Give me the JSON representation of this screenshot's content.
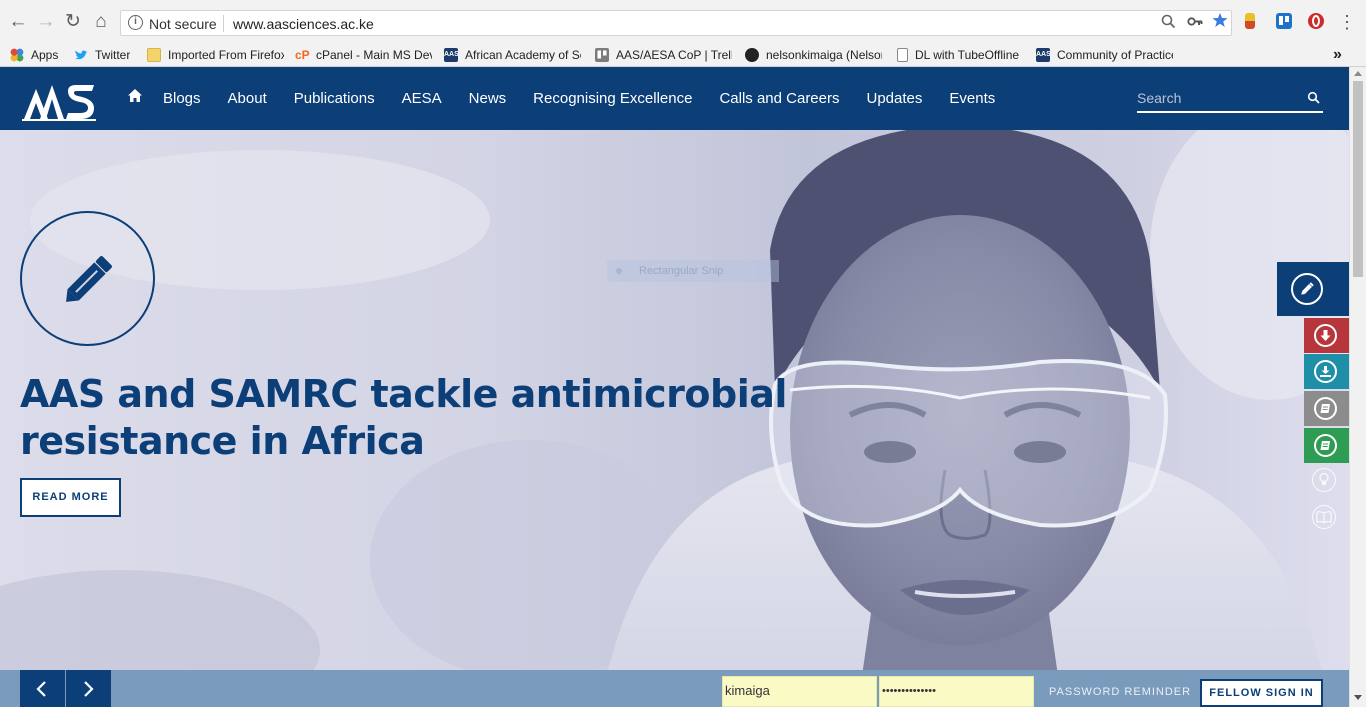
{
  "browser": {
    "back": "←",
    "forward": "→",
    "reload": "↻",
    "home": "⌂",
    "security_label": "Not secure",
    "url": "www.aasciences.ac.ke",
    "bookmarks_overflow": "»",
    "bookmarks": [
      {
        "label": "Apps",
        "icon": "apps-grid-icon"
      },
      {
        "label": "Twitter",
        "icon": "twitter-bird-icon"
      },
      {
        "label": "Imported From Firefox",
        "icon": "folder-icon"
      },
      {
        "label": "cPanel - Main MS Dev",
        "icon": "cpanel-icon"
      },
      {
        "label": "African Academy of Sciences",
        "icon": "aas-icon"
      },
      {
        "label": "AAS/AESA CoP | Trello",
        "icon": "trello-icon"
      },
      {
        "label": "nelsonkimaiga (Nelson",
        "icon": "github-icon"
      },
      {
        "label": "DL with TubeOffline",
        "icon": "page-icon"
      },
      {
        "label": "Community of Practice",
        "icon": "aas-icon"
      }
    ]
  },
  "site": {
    "nav_home_icon": "home-icon",
    "nav": [
      "Blogs",
      "About",
      "Publications",
      "AESA",
      "News",
      "Recognising Excellence",
      "Calls and Careers",
      "Updates",
      "Events"
    ],
    "search_placeholder": "Search"
  },
  "hero": {
    "headline": "AAS and SAMRC tackle antimicrobial resistance in Africa",
    "cta": "READ MORE",
    "snip_label": "Rectangular Snip"
  },
  "sidebar_icons": [
    "pencil-icon",
    "download-circle-icon",
    "download-tray-icon",
    "book-icon",
    "book-icon",
    "lightbulb-icon",
    "open-book-icon"
  ],
  "colors": {
    "brand_navy": "#0c3e78",
    "red": "#b7363c",
    "teal": "#1f8fa8",
    "grey": "#8c8c8c",
    "green": "#2e9c53",
    "footer_bar": "#7b9bbc"
  },
  "login": {
    "username": "kimaiga",
    "password": "••••••••••••••",
    "reminder": "PASSWORD REMINDER",
    "signin": "FELLOW SIGN IN"
  }
}
